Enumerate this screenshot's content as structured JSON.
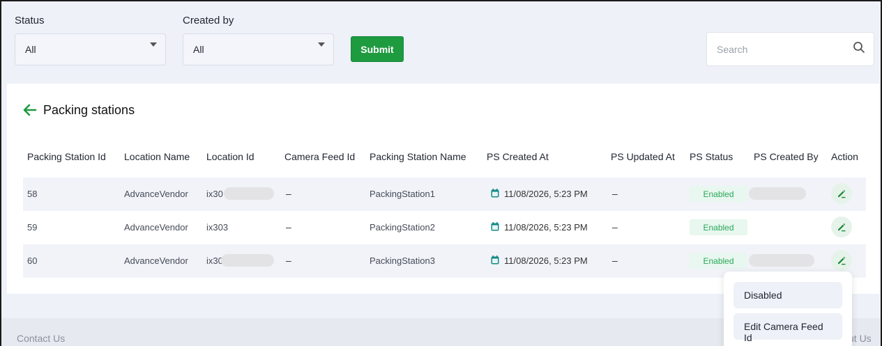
{
  "filters": {
    "status_label": "Status",
    "status_value": "All",
    "created_by_label": "Created by",
    "created_by_value": "All",
    "submit_label": "Submit",
    "search_placeholder": "Search"
  },
  "page": {
    "title": "Packing stations"
  },
  "table": {
    "columns": [
      "Packing Station Id",
      "Location Name",
      "Location Id",
      "Camera Feed Id",
      "Packing Station Name",
      "PS Created At",
      "PS Updated At",
      "PS Status",
      "PS Created By",
      "Action"
    ],
    "rows": [
      {
        "id": "58",
        "location_name": "AdvanceVendor",
        "location_id": "ix30",
        "camera_feed_id": "–",
        "name": "PackingStation1",
        "created_at": "11/08/2026, 5:23 PM",
        "updated_at": "–",
        "status": "Enabled"
      },
      {
        "id": "59",
        "location_name": "AdvanceVendor",
        "location_id": "ix303",
        "camera_feed_id": "–",
        "name": "PackingStation2",
        "created_at": "11/08/2026, 5:23 PM",
        "updated_at": "–",
        "status": "Enabled"
      },
      {
        "id": "60",
        "location_name": "AdvanceVendor",
        "location_id": "ix30",
        "camera_feed_id": "–",
        "name": "PackingStation3",
        "created_at": "11/08/2026, 5:23 PM",
        "updated_at": "–",
        "status": "Enabled"
      }
    ]
  },
  "action_menu": {
    "items": [
      "Disabled",
      "Edit Camera Feed Id"
    ]
  },
  "footer": {
    "left": "Contact Us",
    "right": "ut Us"
  },
  "colors": {
    "accent": "#1e9a3f",
    "badge_bg": "#e8f7ef",
    "badge_text": "#2aa85a"
  },
  "icons": {
    "back": "arrow-left-icon",
    "search": "search-icon",
    "date": "calendar-icon",
    "edit": "pencil-icon",
    "caret": "caret-down-icon"
  }
}
